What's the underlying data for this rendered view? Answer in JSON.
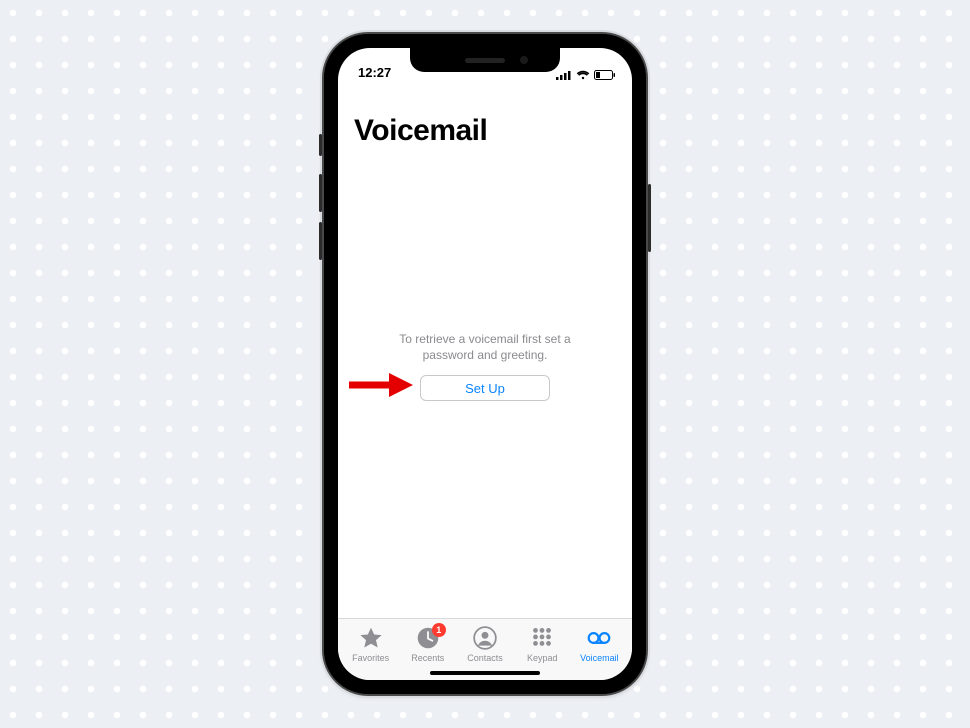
{
  "status": {
    "time": "12:27"
  },
  "page": {
    "title": "Voicemail"
  },
  "content": {
    "hint": "To retrieve a voicemail first set a\npassword and greeting.",
    "setup_label": "Set Up"
  },
  "tabs": {
    "favorites": "Favorites",
    "recents": "Recents",
    "recents_badge": "1",
    "contacts": "Contacts",
    "keypad": "Keypad",
    "voicemail": "Voicemail"
  }
}
